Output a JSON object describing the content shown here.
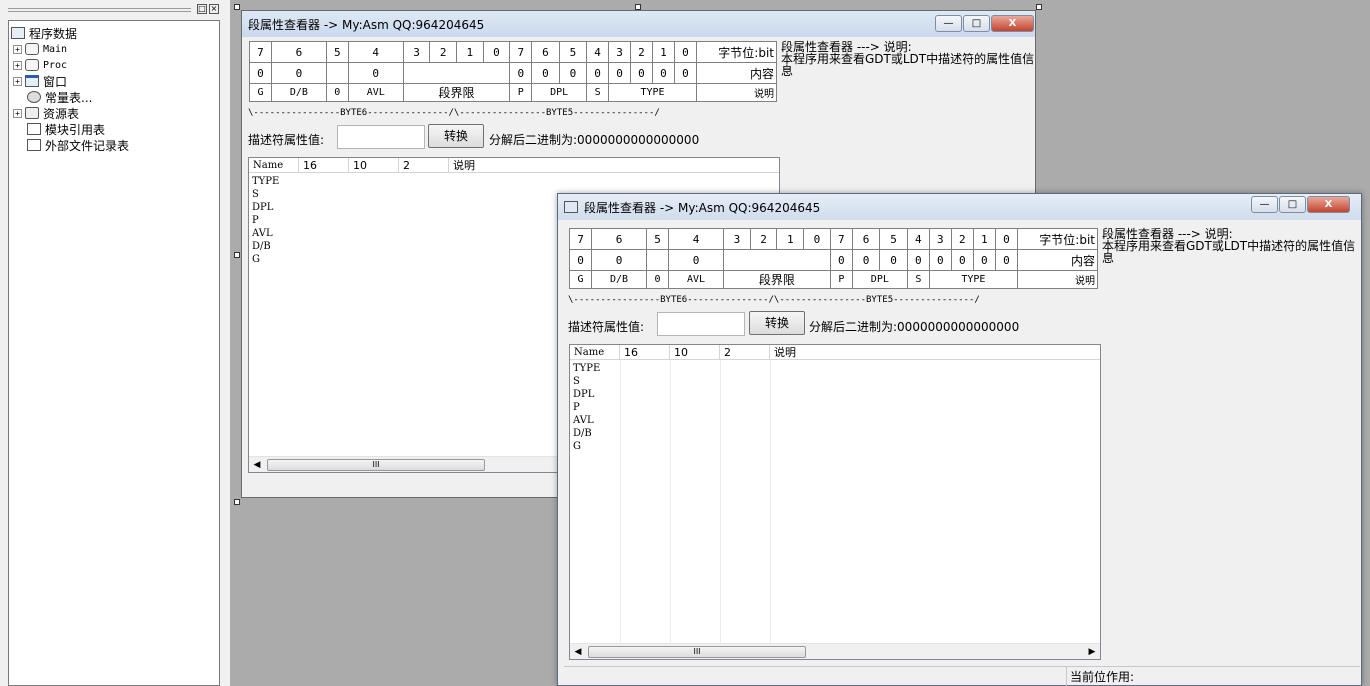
{
  "tree": {
    "items": [
      {
        "label": "程序数据",
        "expander": ""
      },
      {
        "label": "Main",
        "expander": "+"
      },
      {
        "label": "Proc",
        "expander": "+"
      },
      {
        "label": "窗口",
        "expander": "+"
      },
      {
        "label": "常量表...",
        "expander": ""
      },
      {
        "label": "资源表",
        "expander": "+"
      },
      {
        "label": "模块引用表",
        "expander": ""
      },
      {
        "label": "外部文件记录表",
        "expander": ""
      }
    ],
    "dock_buttons": [
      "□",
      "×"
    ]
  },
  "window": {
    "title": "段属性查看器   ->    My:Asm   QQ:964204645",
    "controls": {
      "minimize": "—",
      "maximize": "□",
      "close": "X"
    }
  },
  "bits": {
    "header": [
      "7",
      "6",
      "5",
      "4",
      "3",
      "2",
      "1",
      "0",
      "7",
      "6",
      "5",
      "4",
      "3",
      "2",
      "1",
      "0"
    ],
    "header_label": "字节位:bit",
    "values": [
      "0",
      "0",
      "",
      "0",
      "",
      "",
      "",
      "",
      "0",
      "0",
      "0",
      "0",
      "0",
      "0",
      "0",
      "0"
    ],
    "values_label": "内容",
    "fields": [
      "G",
      "D/B",
      "0",
      "AVL",
      "段界限",
      "P",
      "DPL",
      "S",
      "TYPE"
    ],
    "fields_label": "说明"
  },
  "byte_line": "\\----------------BYTE6---------------/\\----------------BYTE5---------------/",
  "description": {
    "line1": "段属性查看器 ---> 说明:",
    "line2": "本程序用来查看GDT或LDT中描述符的属性值信",
    "line3": "息"
  },
  "form": {
    "input_label": "描述符属性值:",
    "input_value": "",
    "convert_button": "转换",
    "result_text": "分解后二进制为:0000000000000000"
  },
  "list": {
    "columns": [
      "Name",
      "16",
      "10",
      "2",
      "说明"
    ],
    "rows": [
      "TYPE",
      "S",
      "DPL",
      "P",
      "AVL",
      "D/B",
      "G"
    ],
    "scroll_thumb": "III"
  },
  "status": {
    "current_bit_label": "当前位作用:"
  }
}
